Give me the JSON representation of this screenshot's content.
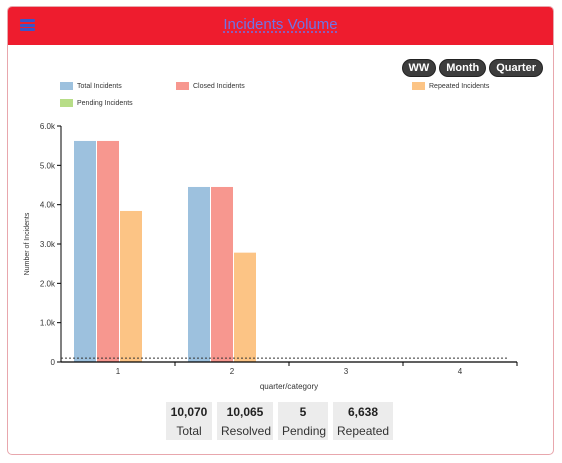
{
  "header": {
    "title": "Incidents Volume",
    "menu_icon": "hamburger-menu-icon"
  },
  "toggles": [
    "WW",
    "Month",
    "Quarter"
  ],
  "colors": {
    "header": "#ee1c2e",
    "total": "#9dc1de",
    "closed": "#f7978f",
    "repeated": "#fcc485",
    "pending": "#b7dd87"
  },
  "chart_data": {
    "type": "bar",
    "xlabel": "quarter/category",
    "ylabel": "Number of Incidents",
    "categories": [
      "1",
      "2",
      "3",
      "4"
    ],
    "ylim": [
      0,
      6000
    ],
    "yticks": [
      "0",
      "1.0k",
      "2.0k",
      "3.0k",
      "4.0k",
      "5.0k",
      "6.0k"
    ],
    "series": [
      {
        "name": "Total Incidents",
        "values": [
          5620,
          4450,
          0,
          0
        ]
      },
      {
        "name": "Closed Incidents",
        "values": [
          5620,
          4450,
          0,
          0
        ]
      },
      {
        "name": "Repeated Incidents",
        "values": [
          3840,
          2780,
          0,
          0
        ]
      },
      {
        "name": "Pending Incidents",
        "values": [
          0,
          5,
          0,
          0
        ]
      }
    ],
    "reference_line": 100,
    "legend": "top"
  },
  "stats": [
    {
      "value": "10,070",
      "label": "Total"
    },
    {
      "value": "10,065",
      "label": "Resolved"
    },
    {
      "value": "5",
      "label": "Pending"
    },
    {
      "value": "6,638",
      "label": "Repeated"
    }
  ]
}
